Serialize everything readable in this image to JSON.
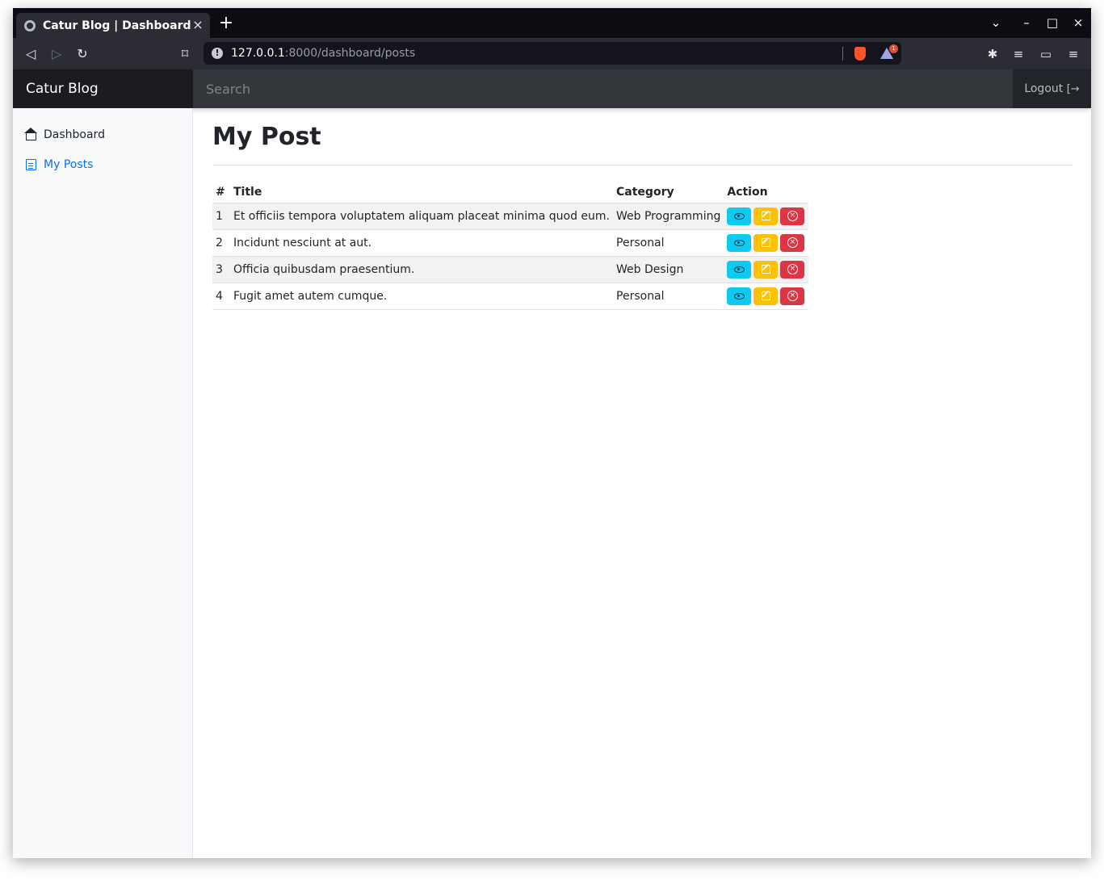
{
  "browser": {
    "tab_title": "Catur Blog | Dashboard",
    "tab_close": "×",
    "new_tab": "+",
    "url_host": "127.0.0.1",
    "url_rest": ":8000/dashboard/posts",
    "info_icon": "!",
    "rewards_badge": "1",
    "icons": [
      "back-icon",
      "forward-icon",
      "reload-icon",
      "bookmark-icon",
      "brave-shield-icon",
      "brave-rewards-icon",
      "extensions-icon",
      "playlist-icon",
      "wallet-icon",
      "menu-icon"
    ]
  },
  "window_controls": {
    "dropdown": "⌄",
    "minimize": "–",
    "maximize": "□",
    "close": "×"
  },
  "header": {
    "brand": "Catur Blog",
    "search_placeholder": "Search",
    "logout_label": "Logout"
  },
  "sidebar": {
    "items": [
      {
        "label": "Dashboard",
        "icon": "home-icon",
        "active": false
      },
      {
        "label": "My Posts",
        "icon": "file-text-icon",
        "active": true
      }
    ]
  },
  "main": {
    "title": "My Post",
    "table": {
      "headers": [
        "#",
        "Title",
        "Category",
        "Action"
      ],
      "rows": [
        {
          "num": "1",
          "title": "Et officiis tempora voluptatem aliquam placeat minima quod eum.",
          "category": "Web Programming"
        },
        {
          "num": "2",
          "title": "Incidunt nesciunt at aut.",
          "category": "Personal"
        },
        {
          "num": "3",
          "title": "Officia quibusdam praesentium.",
          "category": "Web Design"
        },
        {
          "num": "4",
          "title": "Fugit amet autem cumque.",
          "category": "Personal"
        }
      ]
    }
  },
  "colors": {
    "primary": "#0d6efd",
    "info": "#0dcaf0",
    "warning": "#ffc107",
    "danger": "#dc3545",
    "navbar": "#212529"
  }
}
